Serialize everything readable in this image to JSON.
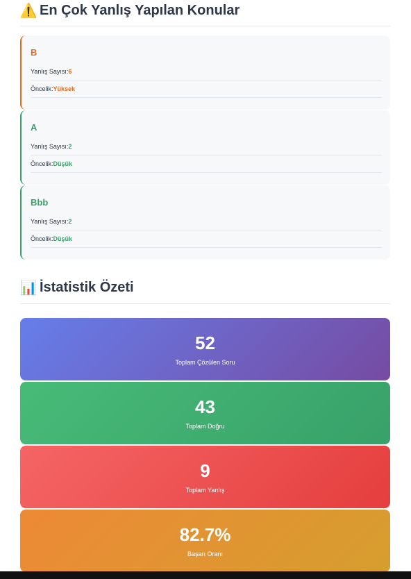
{
  "section1": {
    "icon": "⚠️",
    "title": "En Çok Yanlış Yapılan Konular"
  },
  "topics": [
    {
      "name": "B",
      "wrong_label": "Yanlış Sayısı:",
      "wrong_value": "6",
      "priority_label": "Öncelik:",
      "priority_value": "Yüksek"
    },
    {
      "name": "A",
      "wrong_label": "Yanlış Sayısı:",
      "wrong_value": "2",
      "priority_label": "Öncelik:",
      "priority_value": "Düşük"
    },
    {
      "name": "Bbb",
      "wrong_label": "Yanlış Sayısı:",
      "wrong_value": "2",
      "priority_label": "Öncelik:",
      "priority_value": "Düşük"
    }
  ],
  "section2": {
    "icon": "📊",
    "title": "İstatistik Özeti"
  },
  "stats": [
    {
      "value": "52",
      "label": "Toplam Çözülen Soru"
    },
    {
      "value": "43",
      "label": "Toplam Doğru"
    },
    {
      "value": "9",
      "label": "Toplam Yanlış"
    },
    {
      "value": "82.7%",
      "label": "Başarı Oranı"
    }
  ],
  "colors": {
    "priority_high": "#dd6b20",
    "priority_low": "#38a169"
  }
}
